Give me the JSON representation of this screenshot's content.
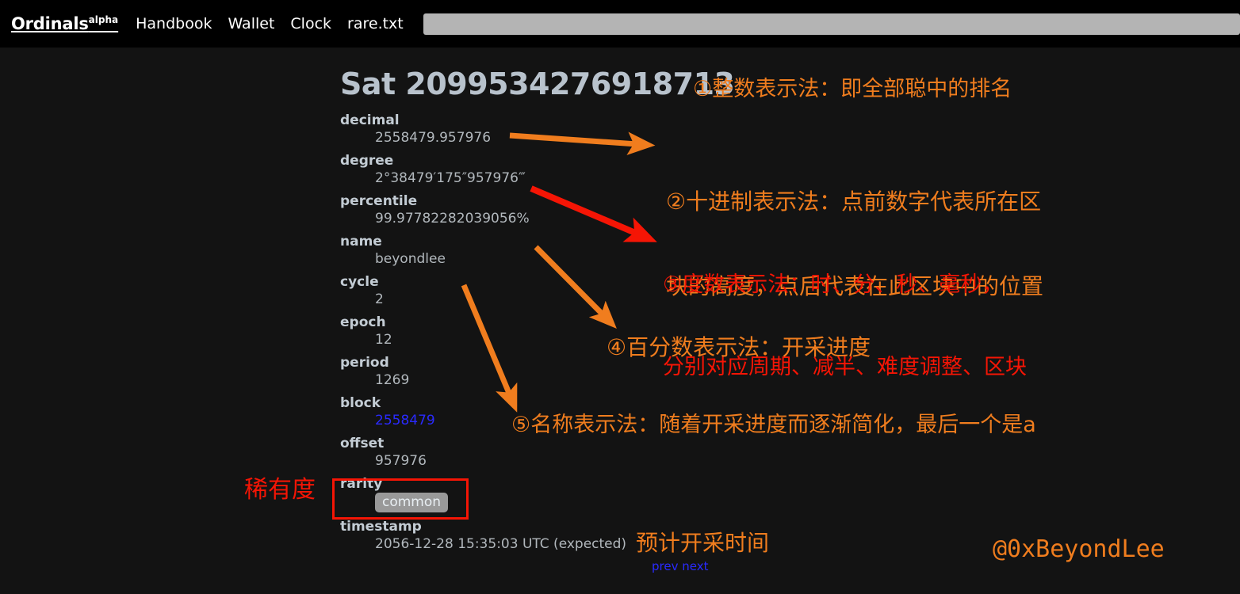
{
  "header": {
    "brand_name": "Ordinals",
    "brand_sup": "alpha",
    "nav": [
      {
        "label": "Handbook",
        "name": "nav-handbook"
      },
      {
        "label": "Wallet",
        "name": "nav-wallet"
      },
      {
        "label": "Clock",
        "name": "nav-clock"
      },
      {
        "label": "rare.txt",
        "name": "nav-rare-txt"
      }
    ],
    "search": {
      "value": "",
      "placeholder": ""
    }
  },
  "sat": {
    "title": "Sat 2099534276918713",
    "fields": [
      {
        "key": "decimal",
        "value": "2558479.957976"
      },
      {
        "key": "degree",
        "value": "2°38479′175″957976‴"
      },
      {
        "key": "percentile",
        "value": "99.97782282039056%"
      },
      {
        "key": "name",
        "value": "beyondlee"
      },
      {
        "key": "cycle",
        "value": "2"
      },
      {
        "key": "epoch",
        "value": "12"
      },
      {
        "key": "period",
        "value": "1269"
      },
      {
        "key": "block",
        "value": "2558479"
      },
      {
        "key": "offset",
        "value": "957976"
      },
      {
        "key": "rarity",
        "value": "common"
      },
      {
        "key": "timestamp",
        "value": "2056-12-28 15:35:03 UTC (expected)"
      }
    ],
    "pagination": {
      "prev": "prev",
      "next": "next"
    }
  },
  "annotations": {
    "note_1": "①整数表示法：即全部聪中的排名",
    "note_2_line1": "②十进制表示法：点前数字代表所在区",
    "note_2_line2": "块的高度，点后代表在此区块中的位置",
    "note_3_line1": "③度数表示法：时、分、秒、毫秒，",
    "note_3_line2": "分别对应周期、减半、难度调整、区块",
    "note_4": "④百分数表示法：开采进度",
    "note_5": "⑤名称表示法：随着开采进度而逐渐简化，最后一个是a",
    "note_rarity": "稀有度",
    "note_timestamp": "预计开采时间",
    "handle": "@0xBeyondLee"
  },
  "colors": {
    "background": "#131313",
    "header_bg": "#000000",
    "annotation_orange": "#f07d1e",
    "annotation_red": "#f51505",
    "link_blue": "#2a2aff",
    "label_gray": "#c3ccd4",
    "badge_gray": "#999999"
  }
}
